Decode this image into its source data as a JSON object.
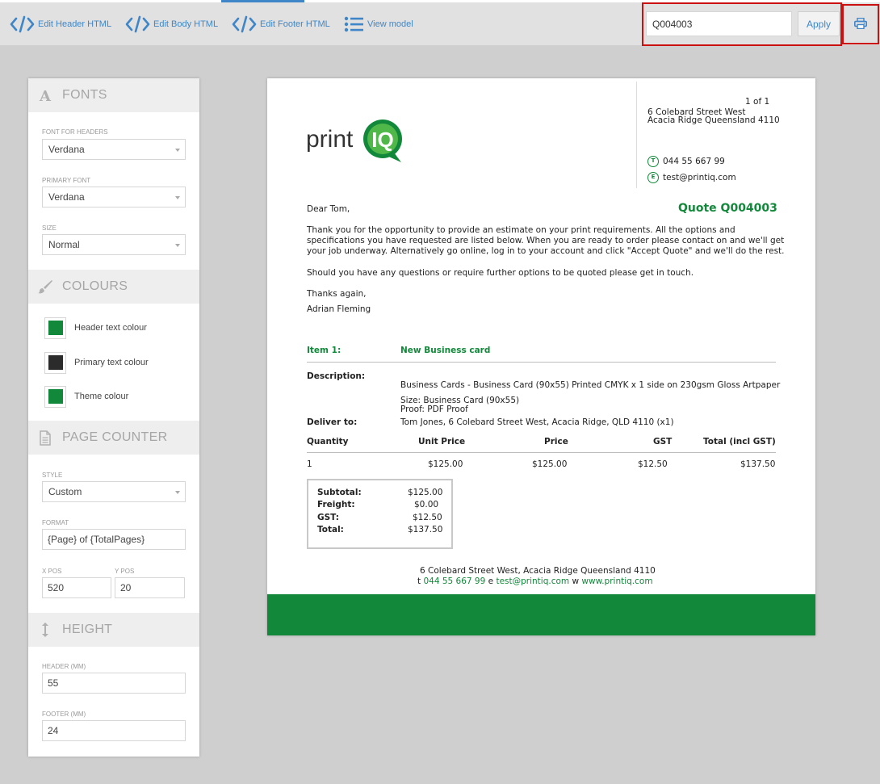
{
  "toolbar": {
    "items": [
      {
        "label": "Edit Header HTML",
        "icon": "code-icon"
      },
      {
        "label": "Edit Body HTML",
        "icon": "code-icon"
      },
      {
        "label": "Edit Footer HTML",
        "icon": "code-icon"
      },
      {
        "label": "View model",
        "icon": "list-icon"
      }
    ],
    "quote_value": "Q004003",
    "apply_label": "Apply",
    "print_icon": "printer-icon",
    "accent_color": "#3f86c8",
    "highlight_color": "#cc1010"
  },
  "sidebar": {
    "fonts": {
      "title": "FONTS",
      "icon": "font-icon",
      "header_font_label": "FONT FOR HEADERS",
      "header_font_value": "Verdana",
      "primary_font_label": "PRIMARY FONT",
      "primary_font_value": "Verdana",
      "size_label": "SIZE",
      "size_value": "Normal"
    },
    "colours": {
      "title": "COLOURS",
      "icon": "brush-icon",
      "items": [
        {
          "label": "Header text colour",
          "color": "#12883a"
        },
        {
          "label": "Primary text colour",
          "color": "#2b2b2b"
        },
        {
          "label": "Theme colour",
          "color": "#12883a"
        }
      ]
    },
    "page_counter": {
      "title": "PAGE COUNTER",
      "icon": "document-icon",
      "style_label": "STYLE",
      "style_value": "Custom",
      "format_label": "FORMAT",
      "format_value": "{Page} of {TotalPages}",
      "xpos_label": "X POS",
      "xpos_value": "520",
      "ypos_label": "Y POS",
      "ypos_value": "20"
    },
    "height": {
      "title": "HEIGHT",
      "icon": "vertical-resize-icon",
      "header_label": "HEADER (MM)",
      "header_value": "55",
      "footer_label": "FOOTER (MM)",
      "footer_value": "24"
    }
  },
  "document": {
    "page_counter": "1 of 1",
    "address_line1": "6 Colebard Street West",
    "address_line2": "Acacia Ridge Queensland 4110",
    "phone_badge": "T",
    "phone": "044 55 667 99",
    "email_badge": "E",
    "email": "test@printiq.com",
    "logo_text": "print",
    "logo_mark": "IQ",
    "salutation": "Dear Tom,",
    "quote_title": "Quote Q004003",
    "para1_line1": "Thank you for the opportunity to provide an estimate on your print requirements. All the options and",
    "para1_line2": "specifications you have requested are listed below. When you are ready to order please contact on and we'll get",
    "para1_line3": "your job underway. Alternatively go online, log in to your account and click \"Accept Quote\" and we'll do the rest.",
    "para2": "Should you have any questions or require further options to be quoted please get in touch.",
    "thanks": "Thanks again,",
    "signature": "Adrian Fleming",
    "item_label": "Item 1:",
    "item_name": "New Business card",
    "description_label": "Description:",
    "description": "Business Cards - Business Card (90x55) Printed CMYK x 1 side on 230gsm Gloss Artpaper",
    "size_line": "Size: Business Card (90x55)",
    "proof_line": "Proof: PDF Proof",
    "deliver_label": "Deliver to:",
    "deliver_value": "Tom Jones, 6 Colebard Street West, Acacia Ridge, QLD 4110 (x1)",
    "table_headers": [
      "Quantity",
      "Unit Price",
      "Price",
      "GST",
      "Total (incl GST)"
    ],
    "table_row": [
      "1",
      "$125.00",
      "$125.00",
      "$12.50",
      "$137.50"
    ],
    "totals": [
      {
        "label": "Subtotal:",
        "value": "$125.00"
      },
      {
        "label": "Freight:",
        "value": "$0.00"
      },
      {
        "label": "GST:",
        "value": "$12.50"
      },
      {
        "label": "Total:",
        "value": "$137.50"
      }
    ],
    "footer_address": "6 Colebard Street West, Acacia Ridge Queensland 4110",
    "footer_t": "t",
    "footer_phone": "044 55 667 99",
    "footer_e": "e",
    "footer_email": "test@printiq.com",
    "footer_w": "w",
    "footer_web": "www.printiq.com",
    "theme_color": "#12883a"
  }
}
